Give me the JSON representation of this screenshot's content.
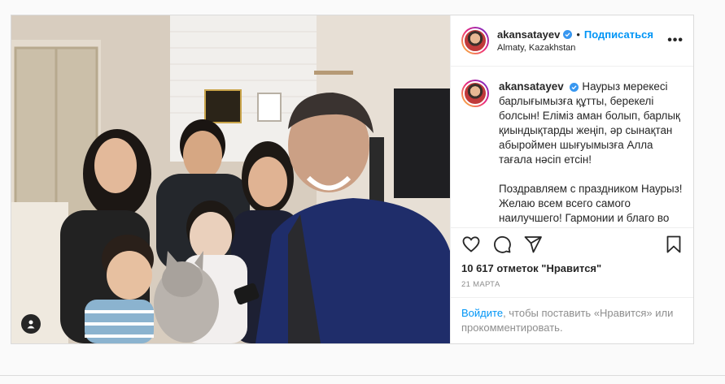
{
  "post": {
    "username": "akansatayev",
    "follow_label": "Подписаться",
    "separator": "•",
    "location": "Almaty, Kazakhstan",
    "more_label": "•••",
    "caption_paragraph_1": "Наурыз мерекесі барлығымызға құтты, берекелі болсын! Еліміз аман болып, барлық қиындықтарды жеңіп, әр сынақтан абыроймен шығуымызға Алла тағала нәсіп етсін!",
    "caption_paragraph_2": "Поздравляем с праздником Наурыз! Желаю всем всего самого наилучшего! Гармонии и благо во всем! Чтобы наша Страна достойно",
    "likes": "10 617 отметок \"Нравится\"",
    "date": "21 МАРТА",
    "login_link": "Войдите",
    "login_rest": ", чтобы поставить «Нравится» или прокомментировать."
  },
  "icons": {
    "verified": "verified-badge-icon",
    "like": "heart-icon",
    "comment": "comment-icon",
    "share": "paper-plane-icon",
    "save": "bookmark-icon",
    "tagged_users": "user-tag-icon"
  },
  "colors": {
    "link_blue": "#0095f6",
    "verified_blue": "#3897f0",
    "text": "#262626",
    "muted": "#8e8e8e",
    "border": "#dbdbdb"
  }
}
